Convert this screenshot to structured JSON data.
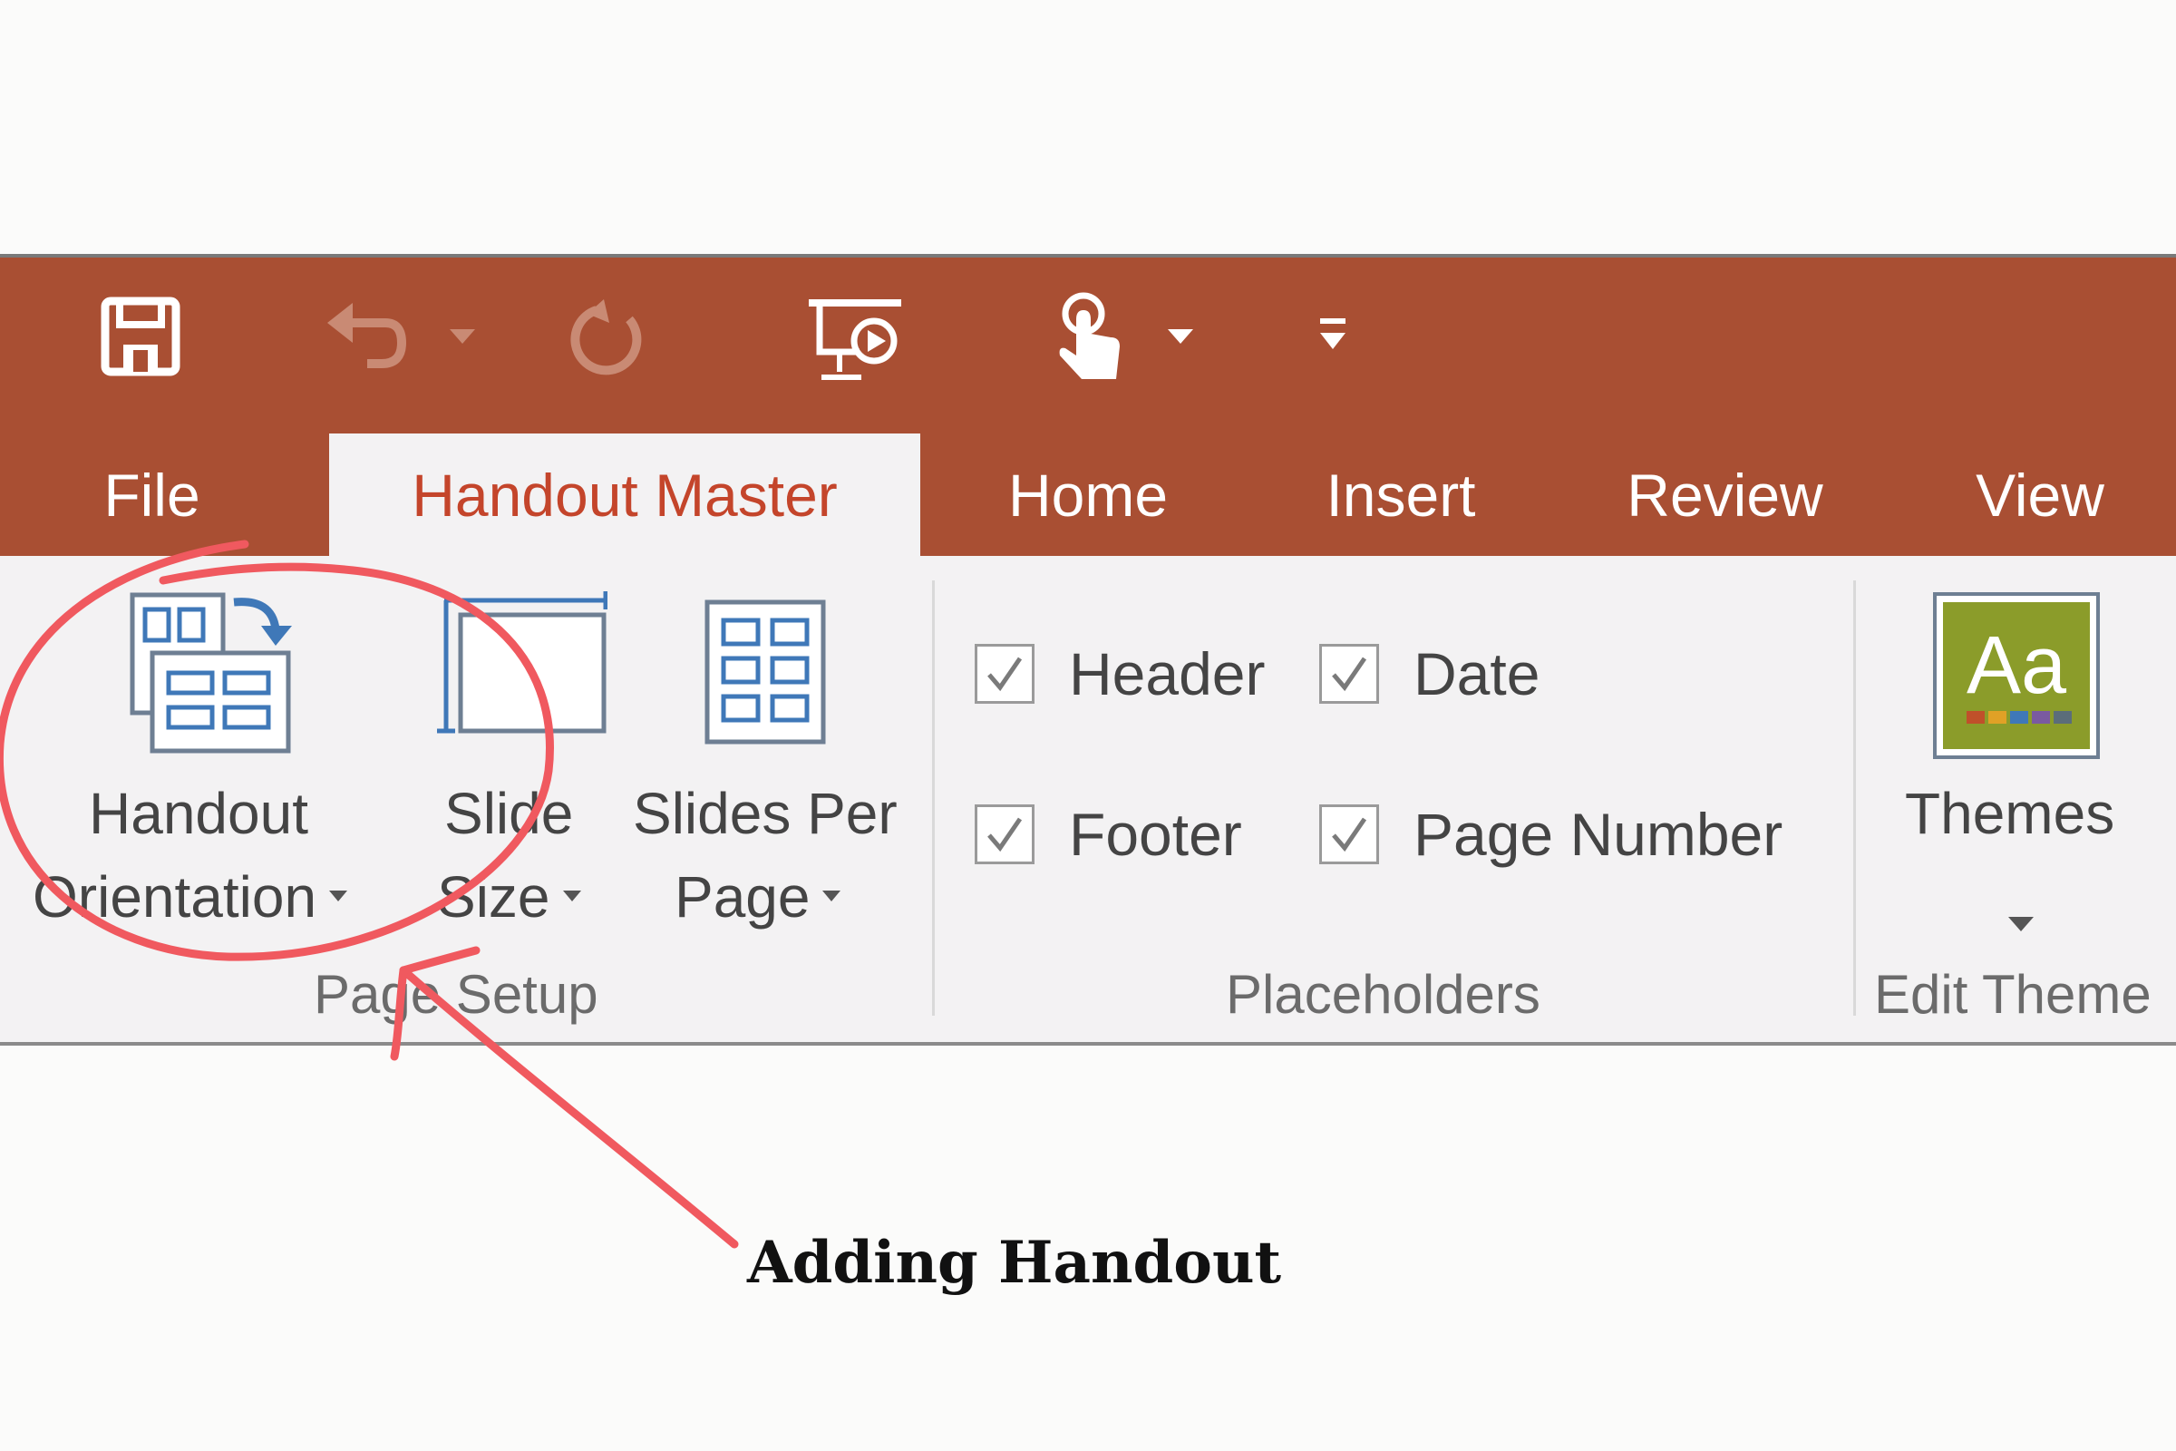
{
  "quick_access": {
    "icons": [
      "save-icon",
      "undo-icon",
      "undo-dropdown-icon",
      "redo-icon",
      "presentation-icon",
      "touch-mode-icon",
      "touch-dropdown-icon",
      "customize-toolbar-icon"
    ]
  },
  "tabs": [
    {
      "label": "File",
      "active": false
    },
    {
      "label": "Handout Master",
      "active": true
    },
    {
      "label": "Home",
      "active": false
    },
    {
      "label": "Insert",
      "active": false
    },
    {
      "label": "Review",
      "active": false
    },
    {
      "label": "View",
      "active": false
    }
  ],
  "ribbon": {
    "page_setup": {
      "group_label": "Page Setup",
      "handout_orientation": {
        "line1": "Handout",
        "line2": "Orientation"
      },
      "slide_size": {
        "line1": "Slide",
        "line2": "Size"
      },
      "slides_per_page": {
        "line1": "Slides Per",
        "line2": "Page"
      }
    },
    "placeholders": {
      "group_label": "Placeholders",
      "header": {
        "label": "Header",
        "checked": true
      },
      "date": {
        "label": "Date",
        "checked": true
      },
      "footer": {
        "label": "Footer",
        "checked": true
      },
      "page_number": {
        "label": "Page Number",
        "checked": true
      }
    },
    "edit_theme": {
      "group_label": "Edit Theme",
      "themes": {
        "label": "Themes",
        "icon_text": "Aa"
      }
    }
  },
  "annotation": {
    "label": "Adding Handout",
    "color": "#f0595f"
  },
  "colors": {
    "titlebar": "#a94f33",
    "active_tab_text": "#c4452b",
    "ribbon_bg": "#f3f2f3",
    "theme_tile": "#8b9c2a"
  }
}
